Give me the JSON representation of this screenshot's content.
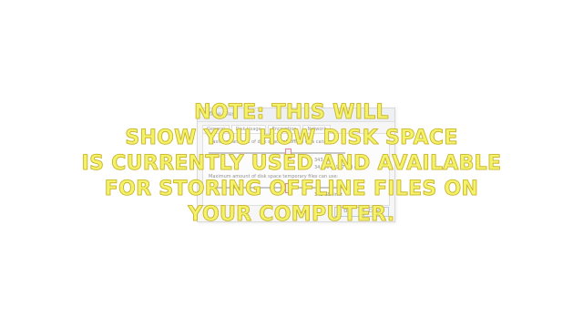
{
  "dialog": {
    "title": "Offline Files",
    "tabs": [
      "General",
      "Disk Usage",
      "Encryption",
      "Network"
    ],
    "active_tab": "Disk Usage",
    "rows": [
      {
        "label": "Maximum amount of disk space all offline files can use:",
        "value": "343 GB"
      },
      {
        "label": "Maximum amount of disk space temporary files can use:",
        "value": "343 GB limit"
      }
    ],
    "detail_lines": [
      "34.4% of 997 GB disk",
      "343 GB limit"
    ],
    "ok_label": "OK",
    "cancel_label": "Cancel",
    "accent_color": "#cc2244"
  },
  "caption": {
    "lines": [
      "NOTE: THIS WILL",
      "SHOW YOU HOW DISK SPACE",
      "IS CURRENTLY USED AND AVAILABLE",
      "FOR STORING OFFLINE FILES ON",
      "YOUR COMPUTER."
    ],
    "text_color": "#f3f36b"
  }
}
